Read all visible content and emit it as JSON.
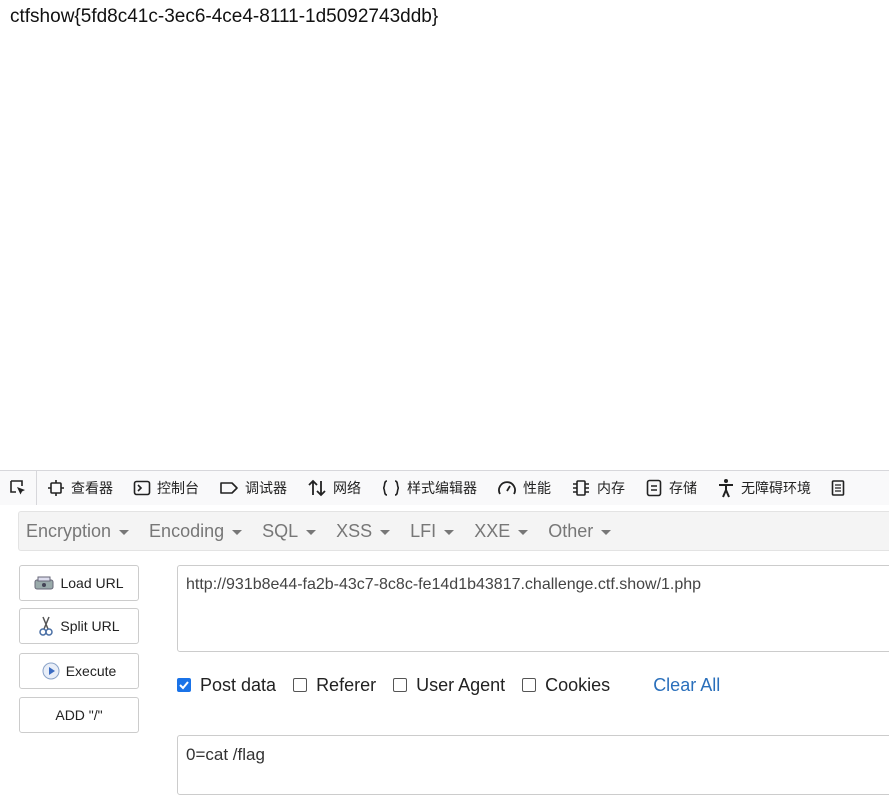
{
  "page": {
    "body_text": "ctfshow{5fd8c41c-3ec6-4ce4-8111-1d5092743ddb}"
  },
  "devtools": {
    "tabs": [
      {
        "label": "查看器",
        "icon": "inspector-icon"
      },
      {
        "label": "控制台",
        "icon": "console-icon"
      },
      {
        "label": "调试器",
        "icon": "debugger-icon"
      },
      {
        "label": "网络",
        "icon": "network-icon"
      },
      {
        "label": "样式编辑器",
        "icon": "style-editor-icon"
      },
      {
        "label": "性能",
        "icon": "performance-icon"
      },
      {
        "label": "内存",
        "icon": "memory-icon"
      },
      {
        "label": "存储",
        "icon": "storage-icon"
      },
      {
        "label": "无障碍环境",
        "icon": "accessibility-icon"
      }
    ]
  },
  "hackbar": {
    "menu": [
      "Encryption",
      "Encoding",
      "SQL",
      "XSS",
      "LFI",
      "XXE",
      "Other"
    ],
    "buttons": {
      "load_url": "Load URL",
      "split_url": "Split URL",
      "execute": "Execute",
      "add_slash": "ADD \"/\""
    },
    "url_value": "http://931b8e44-fa2b-43c7-8c8c-fe14d1b43817.challenge.ctf.show/1.php",
    "options": {
      "post_data": {
        "label": "Post data",
        "checked": true
      },
      "referer": {
        "label": "Referer",
        "checked": false
      },
      "user_agent": {
        "label": "User Agent",
        "checked": false
      },
      "cookies": {
        "label": "Cookies",
        "checked": false
      }
    },
    "clear_all": "Clear All",
    "post_value": "0=cat /flag"
  },
  "colors": {
    "accent": "#1a73e8",
    "link": "#2a6fbb"
  }
}
